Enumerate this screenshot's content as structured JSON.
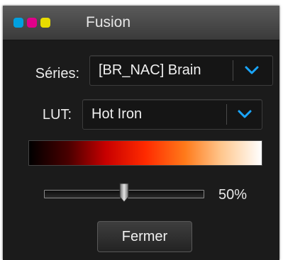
{
  "window": {
    "title": "Fusion",
    "title_dots": [
      "#00a0e0",
      "#e0008a",
      "#e8dc00"
    ]
  },
  "series": {
    "label": "Séries:",
    "value": "[BR_NAC] Brain",
    "dropdown_icon": "chevron-down"
  },
  "lut": {
    "label": "LUT:",
    "value": "Hot Iron",
    "dropdown_icon": "chevron-down",
    "gradient": [
      "#000000",
      "#4a0000",
      "#c80000",
      "#ff2a00",
      "#ff7a1a",
      "#ffc890",
      "#ffffff"
    ]
  },
  "opacity": {
    "value_fraction": 0.5,
    "value_text": "50%"
  },
  "buttons": {
    "close_label": "Fermer"
  },
  "colors": {
    "accent": "#1aa6ff",
    "background": "#1b1b1b",
    "text": "#ececec"
  }
}
